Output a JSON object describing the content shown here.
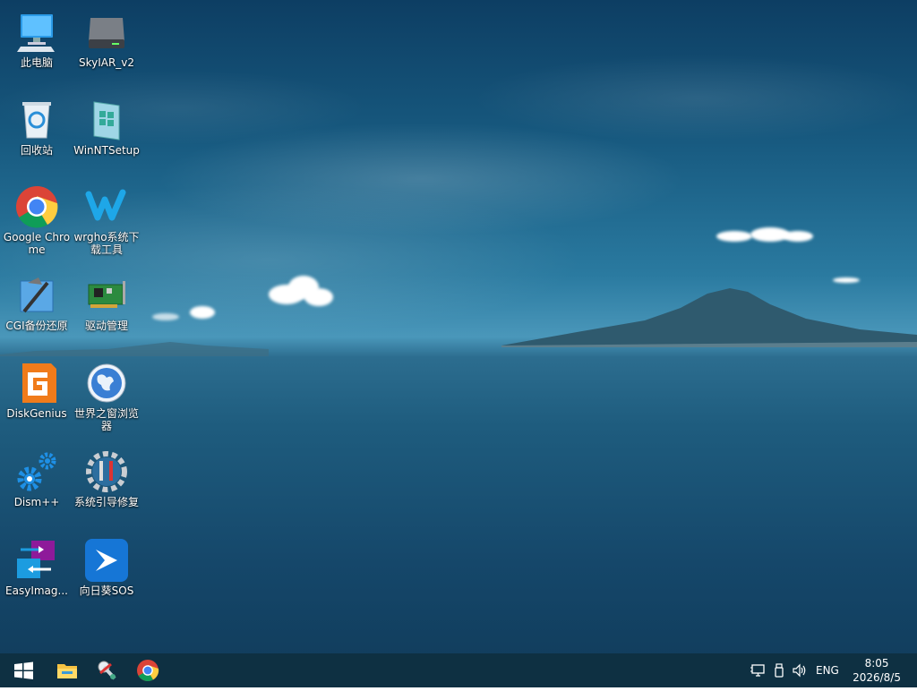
{
  "desktop_icons": [
    {
      "label": "此电脑",
      "icon": "computer-icon"
    },
    {
      "label": "SkyIAR_v2",
      "icon": "drive-icon"
    },
    {
      "label": "回收站",
      "icon": "recycle-bin-icon"
    },
    {
      "label": "WinNTSetup",
      "icon": "winntsetup-icon"
    },
    {
      "label": "Google Chrome",
      "icon": "chrome-icon"
    },
    {
      "label": "wrgho系统下载工具",
      "icon": "wrgho-icon"
    },
    {
      "label": "CGI备份还原",
      "icon": "cgi-icon"
    },
    {
      "label": "驱动管理",
      "icon": "driver-card-icon"
    },
    {
      "label": "DiskGenius",
      "icon": "diskgenius-icon"
    },
    {
      "label": "世界之窗浏览器",
      "icon": "globe-browser-icon"
    },
    {
      "label": "Dism++",
      "icon": "gears-icon"
    },
    {
      "label": "系统引导修复",
      "icon": "repair-gear-icon"
    },
    {
      "label": "EasyImag...",
      "icon": "easyimage-icon"
    },
    {
      "label": "向日葵SOS",
      "icon": "sunflower-sos-icon"
    }
  ],
  "taskbar": {
    "pinned": [
      "start-icon",
      "file-explorer-icon",
      "tool-icon",
      "chrome-icon"
    ],
    "tray": {
      "language": "ENG",
      "time": "8:05",
      "date": "2026/8/5"
    }
  },
  "colors": {
    "taskbar": "#0e3042",
    "windows_blue": "#1e90ff",
    "folder_yellow": "#f5c242"
  }
}
